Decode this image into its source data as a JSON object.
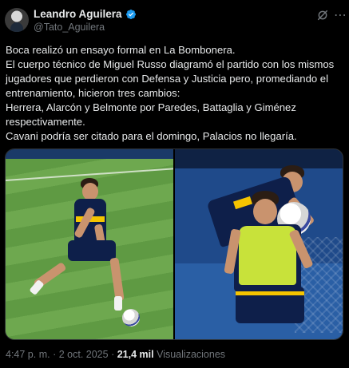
{
  "author": {
    "display_name": "Leandro Aguilera",
    "handle": "@Tato_Aguilera"
  },
  "tweet": {
    "lines": [
      "Boca realizó un ensayo formal en La Bombonera.",
      "El cuerpo técnico de Miguel Russo diagramó el partido con los mismos",
      "jugadores que perdieron con Defensa y Justicia pero, promediando el",
      "entrenamiento, hicieron tres cambios:",
      "Herrera, Alarcón y Belmonte por Paredes, Battaglia y Giménez",
      "respectivamente.",
      "Cavani podría ser citado para el domingo, Palacios no llegaría."
    ]
  },
  "media": {
    "count": 2
  },
  "meta": {
    "time": "4:47 p. m.",
    "separator": "·",
    "date": "2 oct. 2025",
    "views_count": "21,4 mil",
    "views_label": "Visualizaciones"
  },
  "colors": {
    "background": "#000000",
    "text": "#e7e9ea",
    "secondary": "#71767b",
    "verified": "#1d9bf0"
  },
  "icons": [
    "verified-badge-icon",
    "grok-icon",
    "more-options-icon"
  ]
}
